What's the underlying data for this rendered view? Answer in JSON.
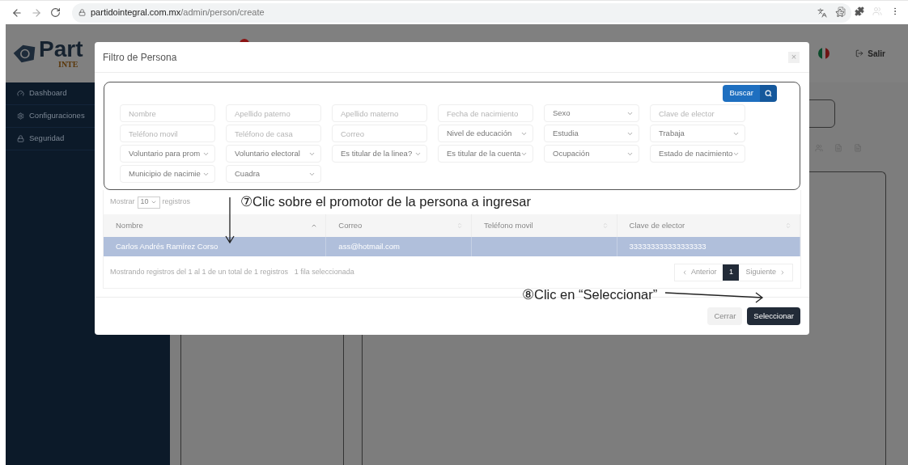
{
  "browser": {
    "url_host": "partidointegral.com.mx",
    "url_path": "/admin/person/create"
  },
  "app": {
    "logo_text": "Part",
    "logo_subtext": "INTE",
    "nav": [
      {
        "label": "Dashboard"
      },
      {
        "label": "Configuraciones"
      },
      {
        "label": "Seguridad"
      }
    ],
    "logout": "Salir"
  },
  "modal": {
    "title": "Filtro de Persona",
    "close": "×",
    "search_button": "Buscar",
    "filters": [
      {
        "kind": "input",
        "placeholder": "Nombre"
      },
      {
        "kind": "input",
        "placeholder": "Apellido paterno"
      },
      {
        "kind": "input",
        "placeholder": "Apellido materno"
      },
      {
        "kind": "input",
        "placeholder": "Fecha de nacimiento"
      },
      {
        "kind": "select",
        "value": "Sexo"
      },
      {
        "kind": "input",
        "placeholder": "Clave de elector"
      },
      {
        "kind": "input",
        "placeholder": "Teléfono movil"
      },
      {
        "kind": "input",
        "placeholder": "Teléfono de casa"
      },
      {
        "kind": "input",
        "placeholder": "Correo"
      },
      {
        "kind": "select",
        "value": "Nivel de educación"
      },
      {
        "kind": "select",
        "value": "Estudia"
      },
      {
        "kind": "select",
        "value": "Trabaja"
      },
      {
        "kind": "select",
        "value": "Voluntario para prom"
      },
      {
        "kind": "select",
        "value": "Voluntario electoral"
      },
      {
        "kind": "select",
        "value": "Es titular de la linea?"
      },
      {
        "kind": "select",
        "value": "Es titular de la cuenta"
      },
      {
        "kind": "select",
        "value": "Ocupación"
      },
      {
        "kind": "select",
        "value": "Estado de nacimiento"
      },
      {
        "kind": "select",
        "value": "Municipio de nacimie"
      },
      {
        "kind": "select",
        "value": "Cuadra"
      }
    ],
    "length_before": "Mostrar",
    "length_value": "10",
    "length_after": "registros",
    "columns": [
      {
        "label": "Nombre",
        "sorted": true
      },
      {
        "label": "Correo",
        "sorted": false
      },
      {
        "label": "Teléfono movil",
        "sorted": false
      },
      {
        "label": "Clave de elector",
        "sorted": false
      }
    ],
    "rows": [
      {
        "cells": [
          "Carlos Andrés Ramírez Corso",
          "ass@hotmail.com",
          "",
          "333333333333333333"
        ],
        "selected": true
      }
    ],
    "info": "Mostrando registros del 1 al 1 de un total de 1 registros",
    "selection_info": "1 fila seleccionada",
    "pagination": {
      "previous": "Anterior",
      "pages": [
        {
          "label": "1",
          "selected": true
        }
      ],
      "next": "Siguiente"
    },
    "buttons": [
      {
        "label": "Cerrar",
        "kind": "secondary"
      },
      {
        "label": "Seleccionar",
        "kind": "primary"
      }
    ]
  },
  "annotations": [
    {
      "text": "⑦Clic sobre el promotor de la persona a ingresar"
    },
    {
      "text": "⑧Clic en “Seleccionar”"
    }
  ]
}
